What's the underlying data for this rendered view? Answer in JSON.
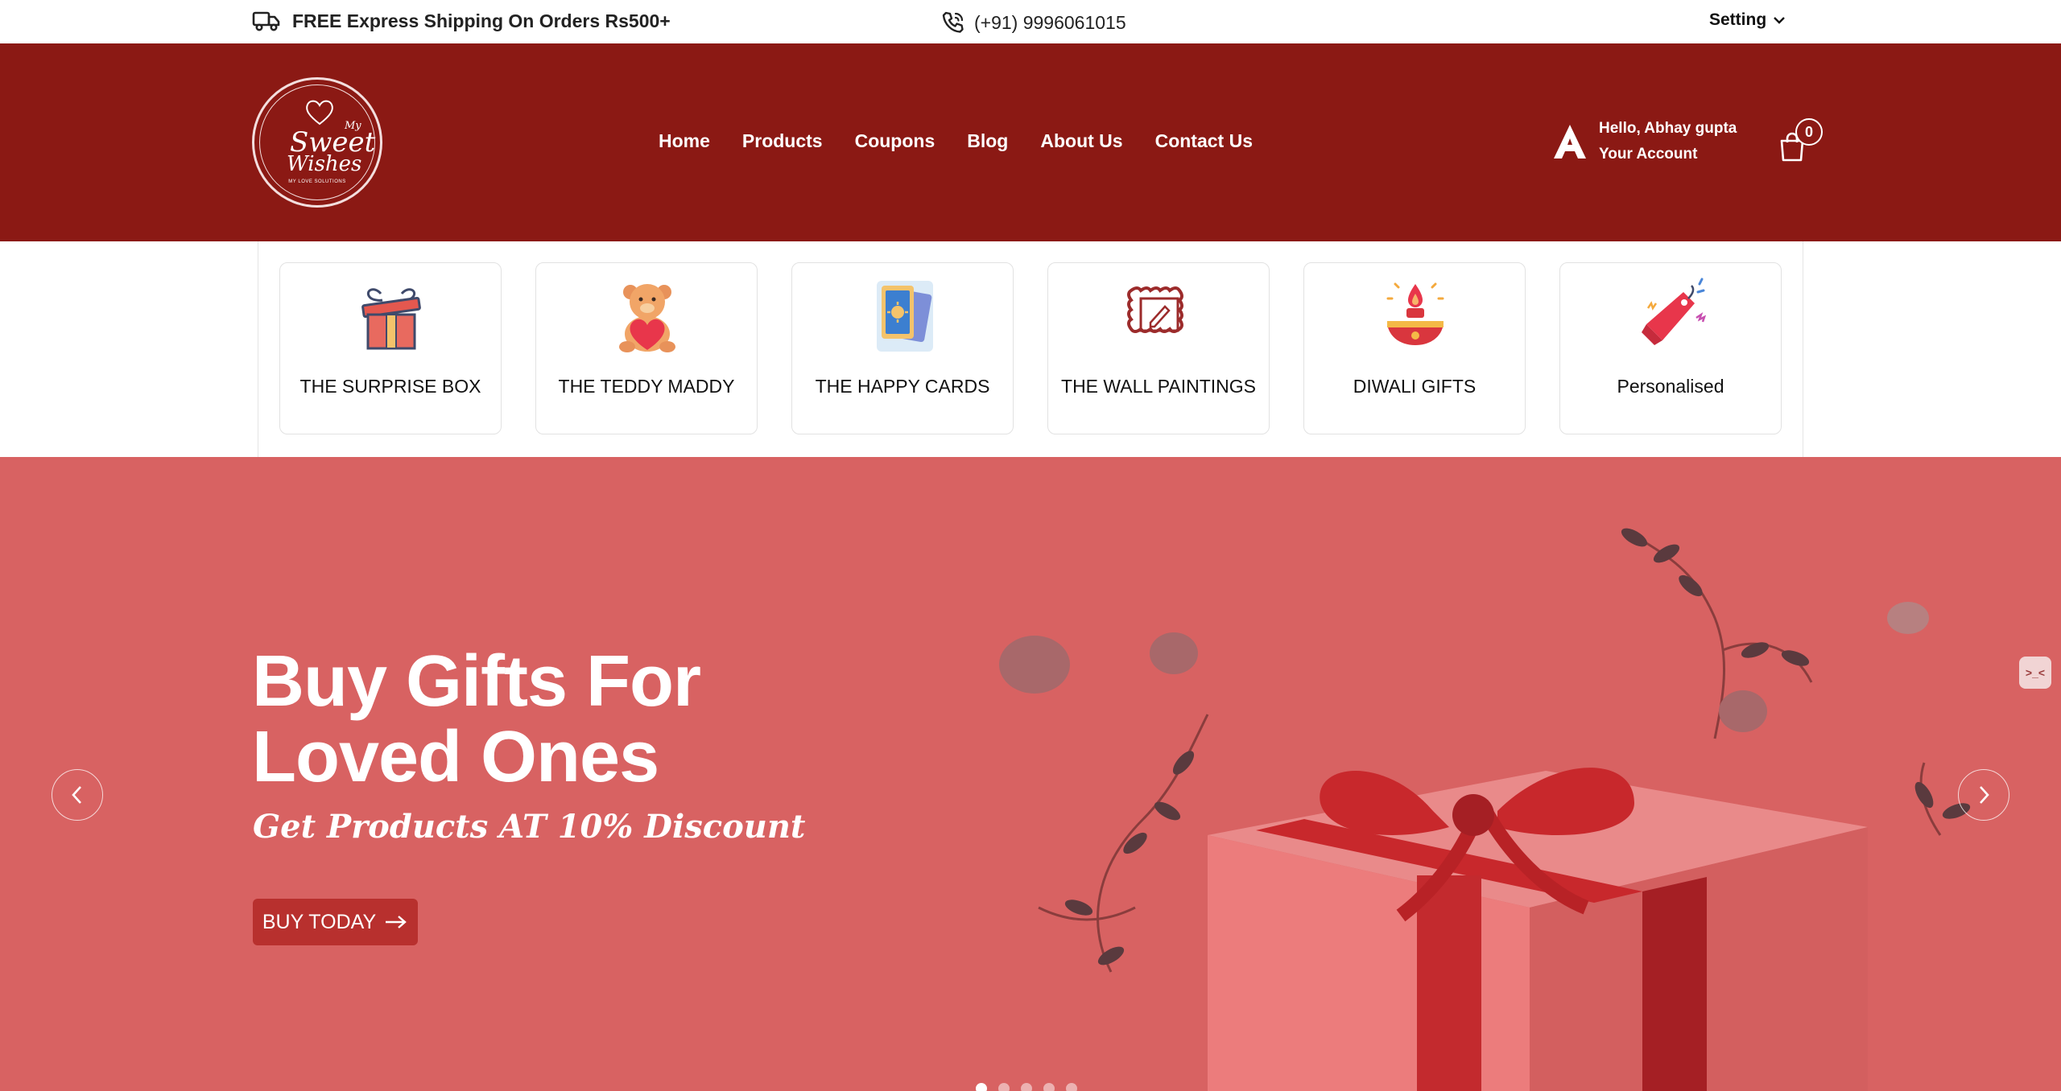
{
  "topbar": {
    "shipping_text": "FREE Express Shipping On Orders Rs500+",
    "phone": "(+91) 9996061015",
    "setting_label": "Setting"
  },
  "header": {
    "logo": {
      "my": "My",
      "sweet": "Sweet",
      "wishes": "Wishes",
      "tagline": "MY LOVE SOLUTIONS"
    },
    "nav": [
      "Home",
      "Products",
      "Coupons",
      "Blog",
      "About Us",
      "Contact Us"
    ],
    "account": {
      "greeting": "Hello, Abhay gupta",
      "label": "Your Account"
    },
    "cart_count": "0"
  },
  "categories": [
    {
      "label": "THE SURPRISE BOX",
      "icon": "gift-box-icon"
    },
    {
      "label": "THE TEDDY MADDY",
      "icon": "teddy-bear-icon"
    },
    {
      "label": "THE HAPPY CARDS",
      "icon": "cards-icon"
    },
    {
      "label": "THE WALL PAINTINGS",
      "icon": "painting-frame-icon"
    },
    {
      "label": "DIWALI GIFTS",
      "icon": "diya-icon"
    },
    {
      "label": "Personalised",
      "icon": "price-tag-icon"
    }
  ],
  "hero": {
    "title_line1": "Buy Gifts For",
    "title_line2": "Loved Ones",
    "subtitle": "Get Products AT 10% Discount",
    "cta": "BUY TODAY",
    "background_color": "#d86262",
    "active_slide": 1,
    "slide_count": 5
  },
  "colors": {
    "header": "#8b1914",
    "hero": "#d86262",
    "cta": "#b8302e"
  }
}
